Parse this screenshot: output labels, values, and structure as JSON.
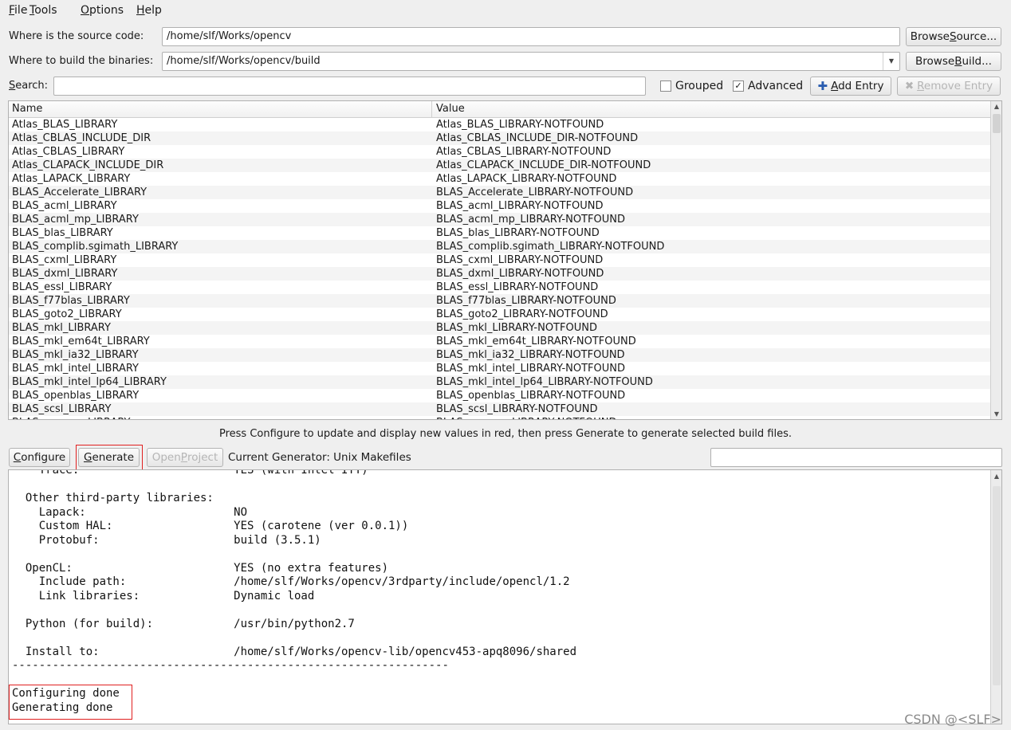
{
  "menu": {
    "items": [
      {
        "mnemonic": "F",
        "rest": "ile"
      },
      {
        "mnemonic": "T",
        "rest": "ools"
      },
      {
        "mnemonic": "O",
        "rest": "ptions"
      },
      {
        "mnemonic": "H",
        "rest": "elp"
      }
    ]
  },
  "source": {
    "label": "Where is the source code:",
    "value": "/home/slf/Works/opencv",
    "browse_pre": "Browse ",
    "browse_mn": "S",
    "browse_post": "ource..."
  },
  "build": {
    "label": "Where to build the binaries:",
    "value": "/home/slf/Works/opencv/build",
    "browse_pre": "Browse ",
    "browse_mn": "B",
    "browse_post": "uild..."
  },
  "search": {
    "label_mn": "S",
    "label_rest": "earch:",
    "value": ""
  },
  "options": {
    "grouped_label": "Grouped",
    "grouped_checked": false,
    "advanced_label": "Advanced",
    "advanced_checked": true,
    "add_entry_mn": "A",
    "add_entry_rest": "dd Entry",
    "remove_entry_mn": "R",
    "remove_entry_rest": "emove Entry"
  },
  "table": {
    "columns": [
      "Name",
      "Value"
    ],
    "rows": [
      [
        "Atlas_BLAS_LIBRARY",
        "Atlas_BLAS_LIBRARY-NOTFOUND"
      ],
      [
        "Atlas_CBLAS_INCLUDE_DIR",
        "Atlas_CBLAS_INCLUDE_DIR-NOTFOUND"
      ],
      [
        "Atlas_CBLAS_LIBRARY",
        "Atlas_CBLAS_LIBRARY-NOTFOUND"
      ],
      [
        "Atlas_CLAPACK_INCLUDE_DIR",
        "Atlas_CLAPACK_INCLUDE_DIR-NOTFOUND"
      ],
      [
        "Atlas_LAPACK_LIBRARY",
        "Atlas_LAPACK_LIBRARY-NOTFOUND"
      ],
      [
        "BLAS_Accelerate_LIBRARY",
        "BLAS_Accelerate_LIBRARY-NOTFOUND"
      ],
      [
        "BLAS_acml_LIBRARY",
        "BLAS_acml_LIBRARY-NOTFOUND"
      ],
      [
        "BLAS_acml_mp_LIBRARY",
        "BLAS_acml_mp_LIBRARY-NOTFOUND"
      ],
      [
        "BLAS_blas_LIBRARY",
        "BLAS_blas_LIBRARY-NOTFOUND"
      ],
      [
        "BLAS_complib.sgimath_LIBRARY",
        "BLAS_complib.sgimath_LIBRARY-NOTFOUND"
      ],
      [
        "BLAS_cxml_LIBRARY",
        "BLAS_cxml_LIBRARY-NOTFOUND"
      ],
      [
        "BLAS_dxml_LIBRARY",
        "BLAS_dxml_LIBRARY-NOTFOUND"
      ],
      [
        "BLAS_essl_LIBRARY",
        "BLAS_essl_LIBRARY-NOTFOUND"
      ],
      [
        "BLAS_f77blas_LIBRARY",
        "BLAS_f77blas_LIBRARY-NOTFOUND"
      ],
      [
        "BLAS_goto2_LIBRARY",
        "BLAS_goto2_LIBRARY-NOTFOUND"
      ],
      [
        "BLAS_mkl_LIBRARY",
        "BLAS_mkl_LIBRARY-NOTFOUND"
      ],
      [
        "BLAS_mkl_em64t_LIBRARY",
        "BLAS_mkl_em64t_LIBRARY-NOTFOUND"
      ],
      [
        "BLAS_mkl_ia32_LIBRARY",
        "BLAS_mkl_ia32_LIBRARY-NOTFOUND"
      ],
      [
        "BLAS_mkl_intel_LIBRARY",
        "BLAS_mkl_intel_LIBRARY-NOTFOUND"
      ],
      [
        "BLAS_mkl_intel_lp64_LIBRARY",
        "BLAS_mkl_intel_lp64_LIBRARY-NOTFOUND"
      ],
      [
        "BLAS_openblas_LIBRARY",
        "BLAS_openblas_LIBRARY-NOTFOUND"
      ],
      [
        "BLAS_scsl_LIBRARY",
        "BLAS_scsl_LIBRARY-NOTFOUND"
      ],
      [
        "BLAS_sgemm_LIBRARY",
        "BLAS_sgemm_LIBRARY-NOTFOUND"
      ]
    ]
  },
  "hint": "Press Configure to update and display new values in red, then press Generate to generate selected build files.",
  "actions": {
    "configure_mn": "C",
    "configure_rest": "onfigure",
    "generate_mn": "G",
    "generate_rest": "enerate",
    "open_project_pre": "Open ",
    "open_project_mn": "P",
    "open_project_post": "roject",
    "current_generator": "Current Generator: Unix Makefiles",
    "filter_value": ""
  },
  "output_text": "    Trace:                       YES (with Intel ITT)\n\n  Other third-party libraries:\n    Lapack:                      NO\n    Custom HAL:                  YES (carotene (ver 0.0.1))\n    Protobuf:                    build (3.5.1)\n\n  OpenCL:                        YES (no extra features)\n    Include path:                /home/slf/Works/opencv/3rdparty/include/opencl/1.2\n    Link libraries:              Dynamic load\n\n  Python (for build):            /usr/bin/python2.7\n\n  Install to:                    /home/slf/Works/opencv-lib/opencv453-apq8096/shared\n-----------------------------------------------------------------\n\nConfiguring done\nGenerating done",
  "watermark": "CSDN @<SLF>",
  "colors": {
    "highlight_box": "#e02020"
  }
}
